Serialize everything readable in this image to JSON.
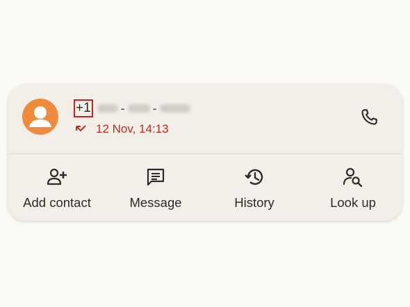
{
  "contact": {
    "number_prefix": "+1",
    "dash": "-",
    "call_time": "12 Nov, 14:13"
  },
  "colors": {
    "accent_missed": "#c0281f",
    "avatar_bg": "#f08a3d",
    "highlight_box": "#d61b1b"
  },
  "icons": {
    "avatar": "person-icon",
    "missed": "missed-call-icon",
    "call": "phone-icon"
  },
  "actions": [
    {
      "label": "Add contact",
      "icon": "add-person-icon"
    },
    {
      "label": "Message",
      "icon": "message-icon"
    },
    {
      "label": "History",
      "icon": "history-icon"
    },
    {
      "label": "Look up",
      "icon": "person-search-icon"
    }
  ]
}
